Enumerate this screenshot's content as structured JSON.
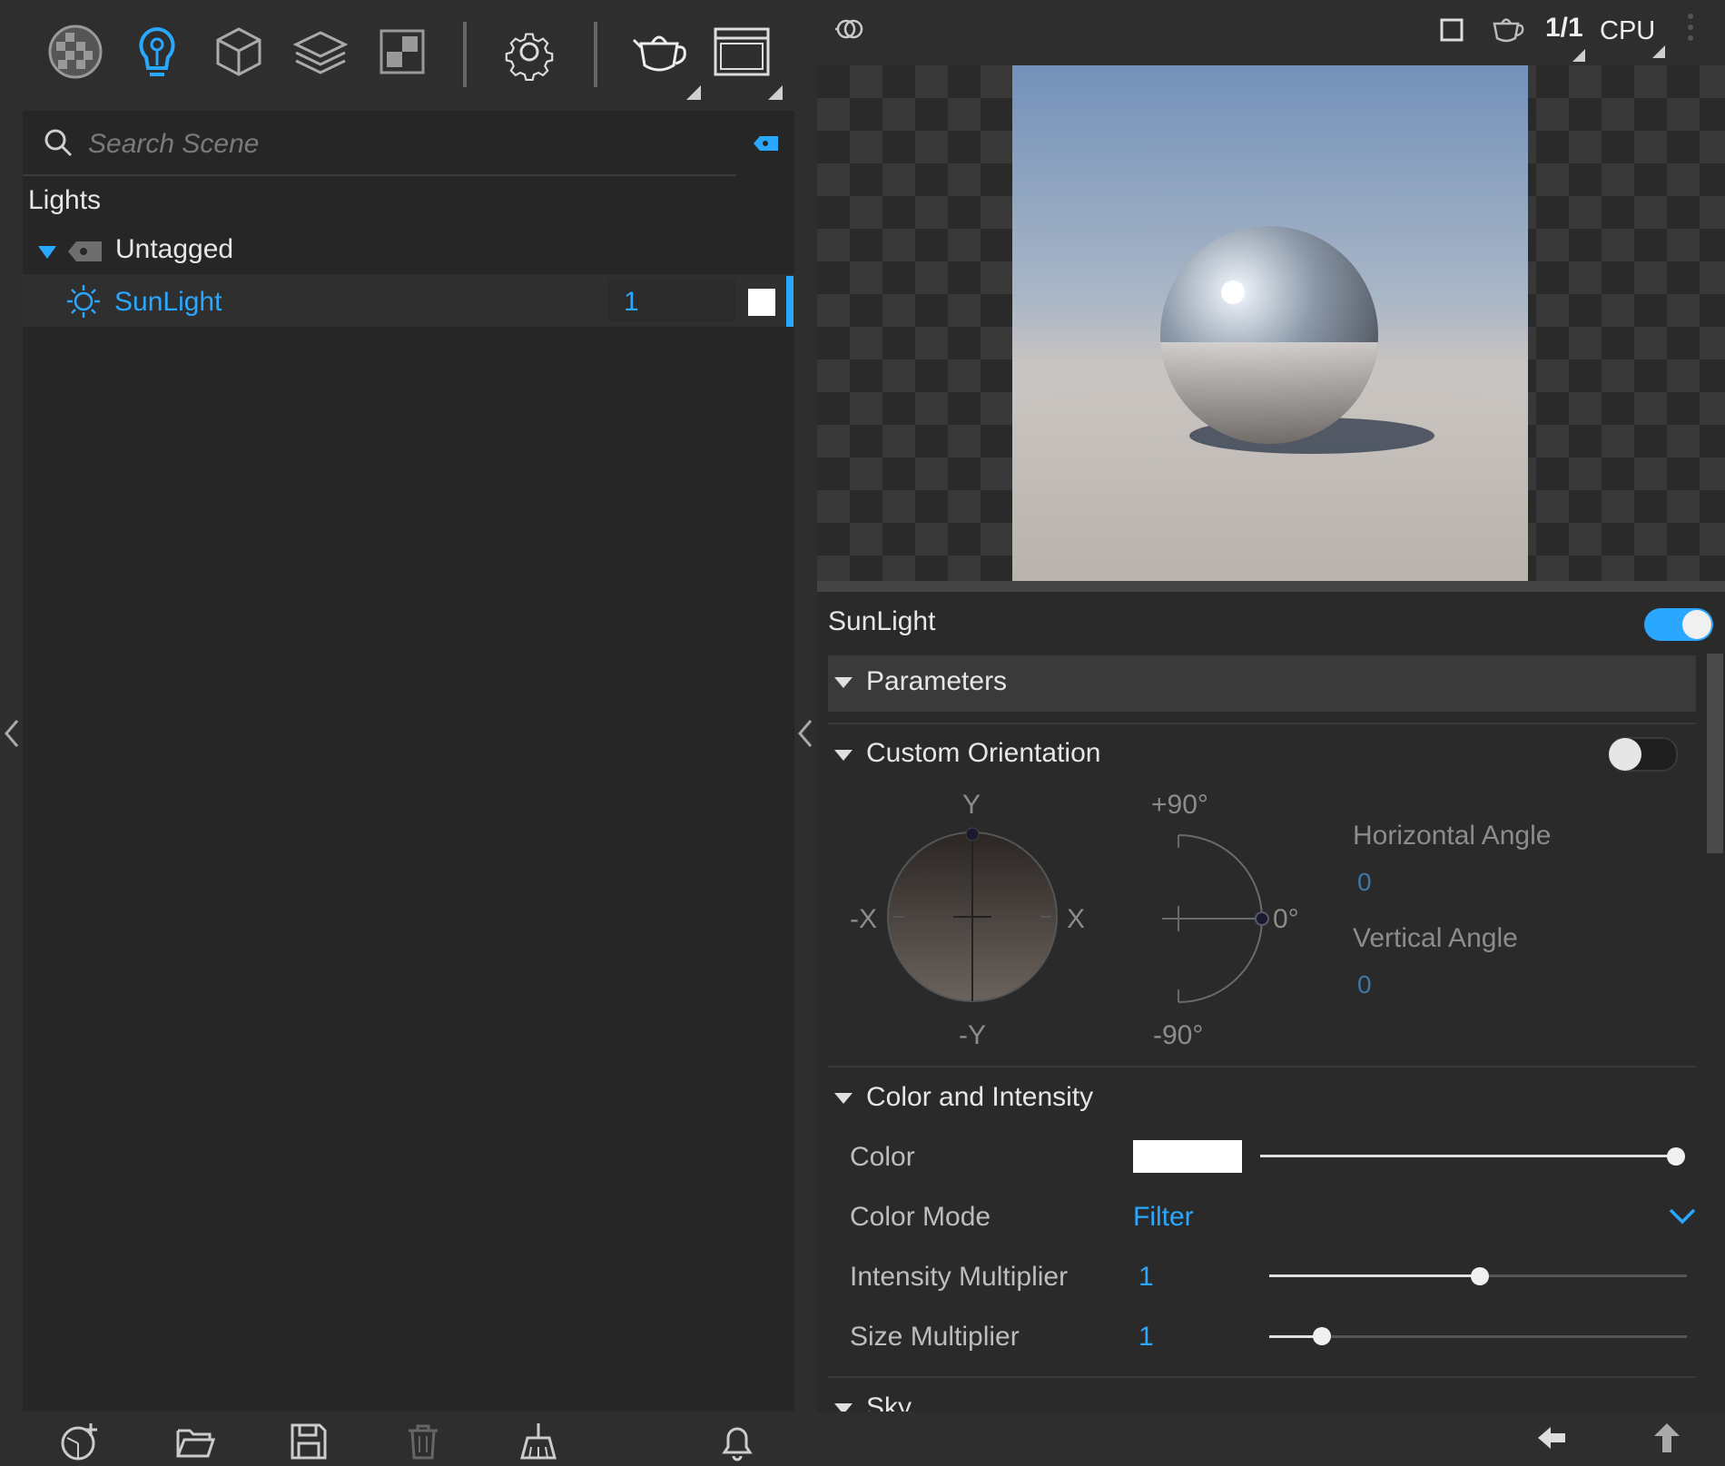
{
  "toolbar": {
    "icons": [
      "material-ball-icon",
      "light-bulb-icon",
      "cube-icon",
      "layers-icon",
      "texture-icon",
      "gear-icon",
      "teapot-icon",
      "window-icon"
    ]
  },
  "outliner": {
    "search_placeholder": "Search Scene",
    "heading": "Lights",
    "group_label": "Untagged",
    "light_name": "SunLight",
    "light_value": "1"
  },
  "viewport": {
    "resolution_label": "1/1",
    "device_label": "CPU"
  },
  "properties": {
    "object_name": "SunLight",
    "enabled": true,
    "sections": {
      "parameters": "Parameters",
      "custom_orientation": "Custom Orientation",
      "color_intensity": "Color and Intensity",
      "sky": "Sky"
    },
    "custom_orientation_enabled": false,
    "orientation": {
      "y_label": "Y",
      "neg_y_label": "-Y",
      "x_label": "X",
      "neg_x_label": "-X",
      "plus90": "+90°",
      "zero": "0°",
      "minus90": "-90°",
      "horizontal_label": "Horizontal Angle",
      "horizontal_value": "0",
      "vertical_label": "Vertical Angle",
      "vertical_value": "0"
    },
    "color": {
      "label": "Color",
      "swatch": "#ffffff",
      "slider_level": 1.0
    },
    "color_mode": {
      "label": "Color Mode",
      "value": "Filter"
    },
    "intensity": {
      "label": "Intensity Multiplier",
      "value": "1",
      "slider_level": 0.5
    },
    "size": {
      "label": "Size Multiplier",
      "value": "1",
      "slider_level": 0.12
    }
  },
  "colors": {
    "accent": "#2aa7ff",
    "panel": "#262626",
    "background": "#2e2e2e"
  }
}
